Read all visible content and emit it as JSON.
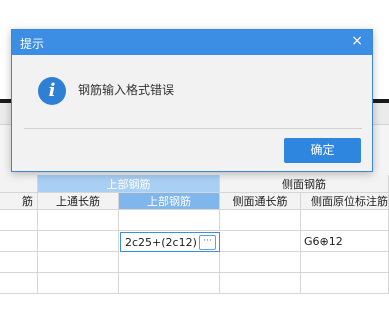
{
  "dialog": {
    "title": "提示",
    "close_glyph": "×",
    "message": "钢筋输入格式错误",
    "ok_label": "确定",
    "info_glyph": "i"
  },
  "grid": {
    "group_headers": {
      "top_rebar": "上部钢筋",
      "side_rebar": "侧面钢筋"
    },
    "columns": {
      "partial_left": "筋",
      "top_continuous": "上通长筋",
      "top_rebar": "上部钢筋",
      "side_continuous": "侧面通长筋",
      "side_original": "侧面原位标注筋"
    },
    "row1": {
      "top_rebar_value": "2c25+(2c12)",
      "side_original_value": "G6⊕12"
    },
    "ellipsis": "···"
  },
  "colors": {
    "accent": "#3b8ee3",
    "selected_header": "#7fb6ec"
  }
}
